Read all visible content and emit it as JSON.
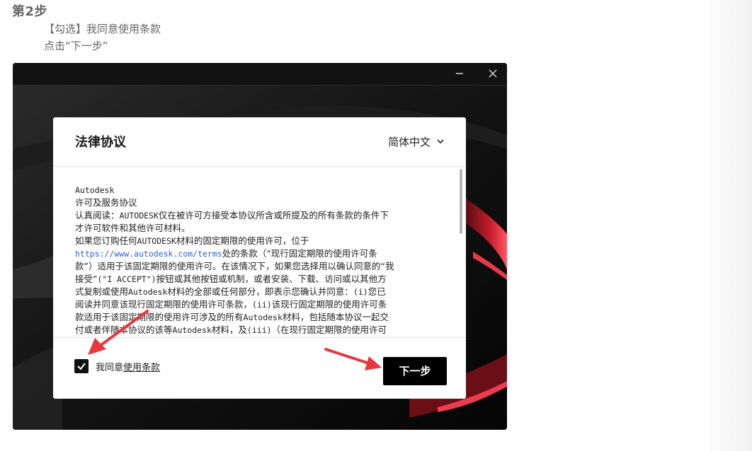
{
  "doc": {
    "step_title": "第2步",
    "instruction_1": "【勾选】我同意使用条款",
    "instruction_2": "点击“下一步”"
  },
  "dialog": {
    "title": "法律协议",
    "language": "简体中文",
    "agreement_lines": {
      "l1": "Autodesk",
      "l2": "许可及服务协议",
      "l3a": "认真阅读：",
      "l3b": "AUTODESK",
      "l3c": "仅在被许可方接受本协议所含或所提及的所有条款的条件下",
      "l4": "才许可软件和其他许可材料。",
      "l5a": "如果您订购任何",
      "l5b": "AUTODESK",
      "l5c": "材料的固定期限的使用许可，位于",
      "l6a": "https://www.autodesk.com/terms",
      "l6b": "处的条款（“现行固定期限的使用许可条",
      "l7": "款”）适用于该固定期限的使用许可。在该情况下，如果您选择用以确认同意的“我",
      "l8a": "接受”",
      "l8b": "(\"I ACCEPT\")",
      "l8c": "按钮或其他按钮或机制，或者安装、下载、访问或以其他方",
      "l9a": "式复制或使用",
      "l9b": "Autodesk",
      "l9c": "材料的全部或任何部分，即表示您确认并同意：",
      "l9d": "(i)",
      "l9e": "您已",
      "l10a": "阅读并同意该现行固定期限的使用许可条款，",
      "l10b": "(ii)",
      "l10c": "该现行固定期限的使用许可条",
      "l11a": "款适用于该固定期限的使用许可涉及的所有",
      "l11b": "Autodesk",
      "l11c": "材料，包括随本协议一起交",
      "l12a": "付或者伴随本协议的该等",
      "l12b": "Autodesk",
      "l12c": "材料，及",
      "l12d": "(iii)",
      "l12e": "（在现行固定期限的使用许可"
    },
    "agree_prefix": "我同意",
    "agree_terms": "使用条款",
    "agree_checked": true,
    "next_label": "下一步"
  },
  "window": {
    "minimize_icon": "minimize-icon",
    "close_icon": "close-icon"
  },
  "colors": {
    "annotation_arrow": "#e8383d",
    "link": "#2b5fd9",
    "primary_button": "#000000"
  }
}
